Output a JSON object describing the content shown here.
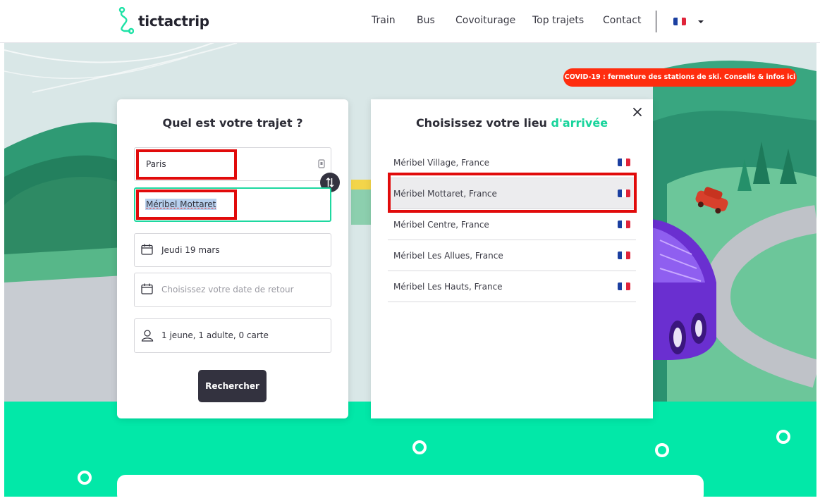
{
  "header": {
    "brand": "tictactrip",
    "nav": [
      "Train",
      "Bus",
      "Covoiturage",
      "Top trajets",
      "Contact"
    ],
    "flag_colors": [
      "#1b3fa0",
      "#ffffff",
      "#e0243a"
    ]
  },
  "banner": {
    "text": "COVID-19 : fermeture des stations de ski. Conseils & infos ici",
    "color": "#ff2d0f"
  },
  "search": {
    "title": "Quel est votre trajet ?",
    "origin_value": "Paris",
    "destination_value": "Méribel Mottaret",
    "outbound_date": "Jeudi 19 mars",
    "return_placeholder": "Choisissez votre date de retour",
    "passengers": "1 jeune, 1 adulte, 0 carte",
    "submit_label": "Rechercher"
  },
  "arrival": {
    "title_prefix": "Choisissez votre lieu ",
    "title_accent": "d'arrivée",
    "accent_color": "#17d49b",
    "items": [
      {
        "label": "Méribel Village, France",
        "flag": "fr-flag-icon"
      },
      {
        "label": "Méribel Mottaret, France",
        "flag": "fr-flag-icon"
      },
      {
        "label": "Méribel Centre, France",
        "flag": "fr-flag-icon"
      },
      {
        "label": "Méribel Les Allues, France",
        "flag": "fr-flag-icon"
      },
      {
        "label": "Méribel Les Hauts, France",
        "flag": "fr-flag-icon"
      }
    ],
    "selected_index": 1
  },
  "icons": {
    "logo": "route-logo-icon",
    "swap": "swap-arrows-icon",
    "calendar": "calendar-icon",
    "person": "person-icon",
    "close": "close-icon",
    "locate": "locate-icon",
    "caret": "caret-down-icon"
  },
  "colors": {
    "brand_mint": "#02e8a8",
    "dark_button": "#33323f",
    "annotation_red": "#e10b0b"
  }
}
